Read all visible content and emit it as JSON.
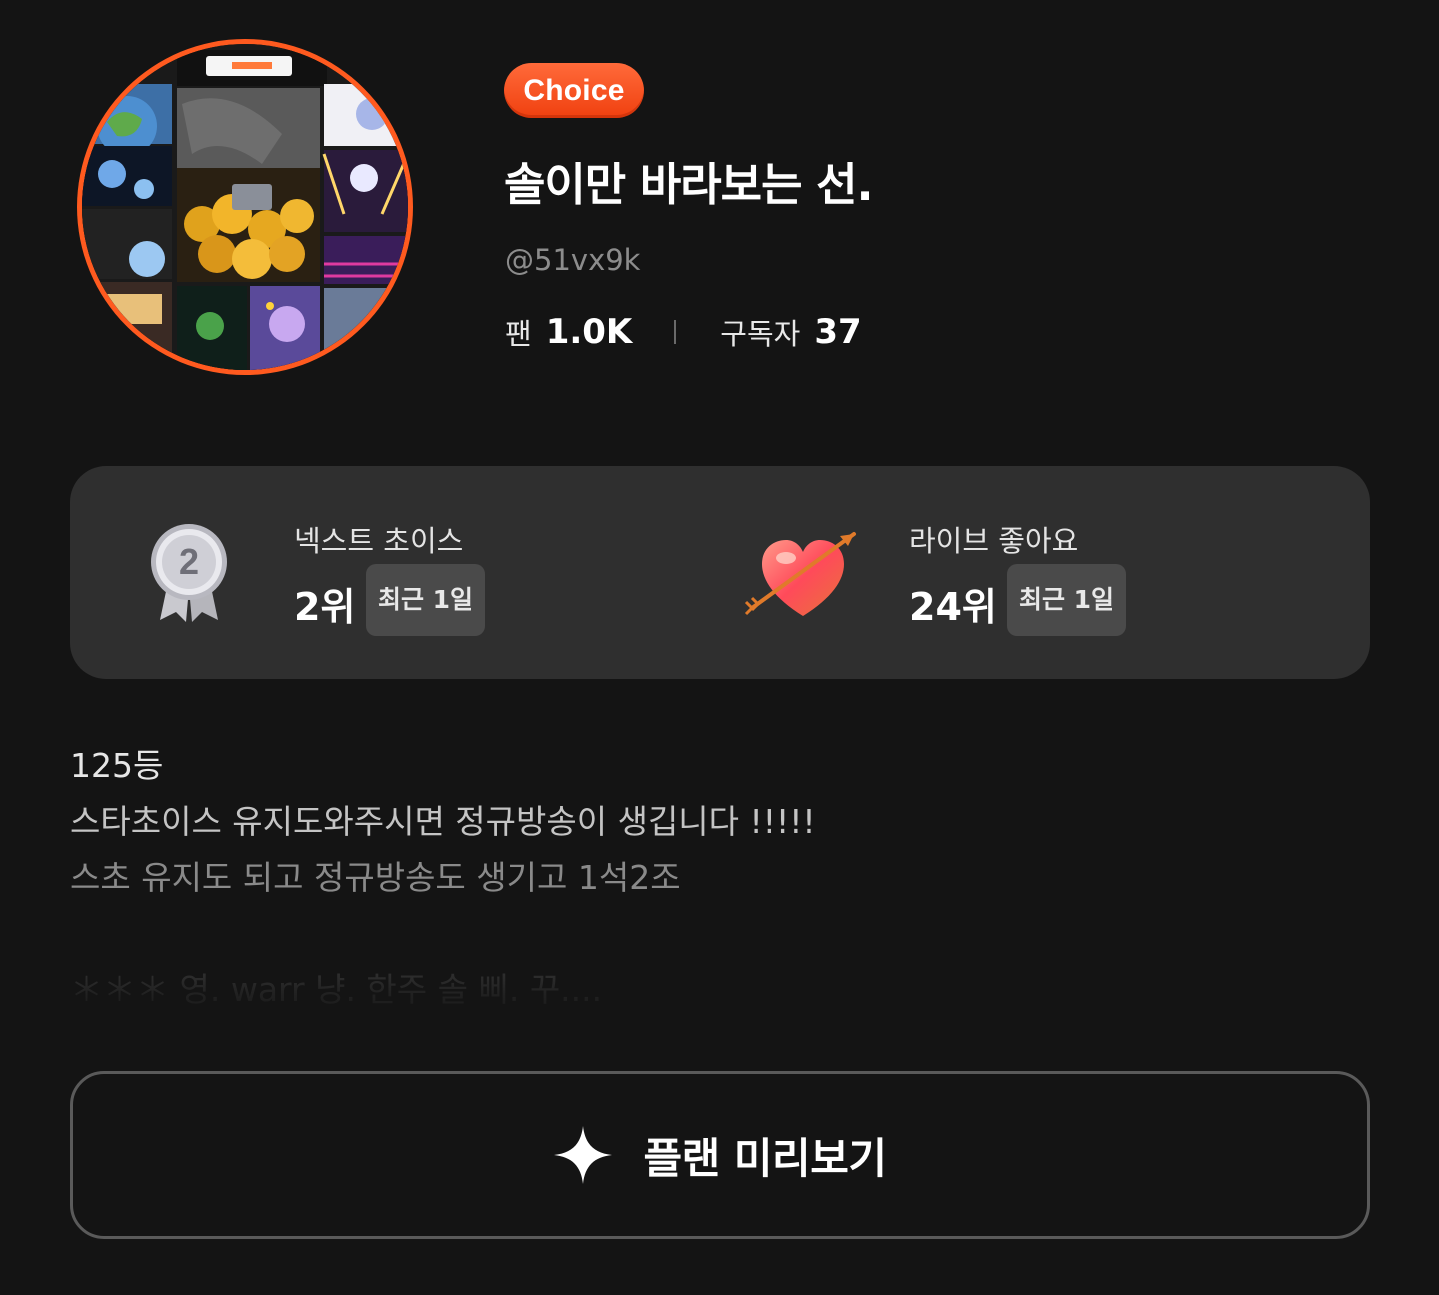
{
  "profile": {
    "badge": "Choice",
    "name": "솔이만 바라보는 선.",
    "handle": "@51vx9k",
    "stats": [
      {
        "label": "팬",
        "value": "1.0K"
      },
      {
        "label": "구독자",
        "value": "37"
      }
    ],
    "accent_color": "#ff5a1f"
  },
  "rankings": [
    {
      "icon": "silver-medal-2-icon",
      "title": "넥스트 초이스",
      "rank": "2위",
      "period": "최근 1일"
    },
    {
      "icon": "heart-arrow-icon",
      "title": "라이브 좋아요",
      "rank": "24위",
      "period": "최근 1일"
    }
  ],
  "description": {
    "lines": [
      "125등",
      "스타초이스 유지도와주시면 정규방송이 생깁니다 !!!!!",
      "스초 유지도 되고 정규방송도 생기고 1석2조",
      "＊＊＊ 영. warr 냥. 한주 솔 삐. 꾸...."
    ]
  },
  "plan_button": {
    "label": "플랜 미리보기",
    "icon": "sparkle-icon"
  }
}
